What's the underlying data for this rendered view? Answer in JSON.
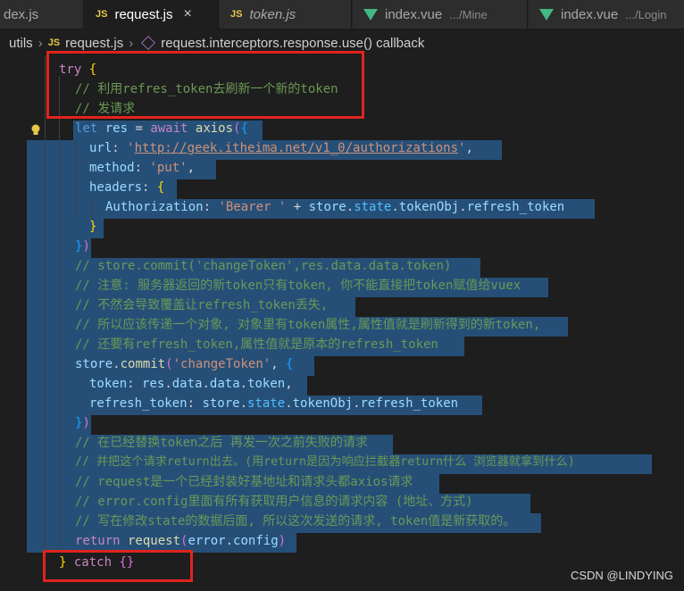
{
  "tabs": [
    {
      "icon": "none",
      "label": "dex.js",
      "sub": "",
      "italic": false,
      "active": false
    },
    {
      "icon": "js",
      "label": "request.js",
      "sub": "",
      "italic": false,
      "active": true,
      "close": "×"
    },
    {
      "icon": "js",
      "label": "token.js",
      "sub": "",
      "italic": true,
      "active": false
    },
    {
      "icon": "vue",
      "label": "index.vue",
      "sub": ".../Mine",
      "italic": false,
      "active": false
    },
    {
      "icon": "vue",
      "label": "index.vue",
      "sub": ".../Login",
      "italic": false,
      "active": false
    }
  ],
  "breadcrumb": {
    "folder": "utils",
    "file_icon": "JS",
    "file": "request.js",
    "symbol": "request.interceptors.response.use() callback"
  },
  "code": {
    "l1": {
      "a": "try",
      "b": " {"
    },
    "l2": "// 利用refres_token去刷新一个新的token",
    "l3": "// 发请求",
    "l4": {
      "a": "let",
      "b": " res",
      "c": " = ",
      "d": "await",
      "e": " axios",
      "f": "(",
      "g": "{"
    },
    "l5": {
      "a": "url",
      "b": ": ",
      "c": "'",
      "d": "http://geek.itheima.net/v1_0/authorizations",
      "e": "'",
      ",": ","
    },
    "l6": {
      "a": "method",
      "b": ": ",
      "c": "'put'",
      "d": ","
    },
    "l7": {
      "a": "headers",
      "b": ": ",
      "c": "{"
    },
    "l8": {
      "a": "Authorization",
      "b": ": ",
      "c": "'Bearer '",
      "d": " + ",
      "e": "store",
      "f": ".",
      "g": "state",
      "h": ".",
      "i": "tokenObj",
      "j": ".",
      "k": "refresh_token"
    },
    "l9": "}",
    "l10": {
      "a": "}",
      "b": ")"
    },
    "l11": "// store.commit('changeToken',res.data.data.token)",
    "l12": "// 注意: 服务器返回的新token只有token, 你不能直接把token赋值给vuex",
    "l13": "// 不然会导致覆盖让refresh_token丢失,",
    "l14": "// 所以应该传递一个对象, 对象里有token属性,属性值就是刷新得到的新token,",
    "l15": "// 还要有refresh_token,属性值就是原本的refresh_token",
    "l16": {
      "a": "store",
      "b": ".",
      "c": "commit",
      "d": "(",
      "e": "'changeToken'",
      "f": ", ",
      "g": "{"
    },
    "l17": {
      "a": "token",
      "b": ": ",
      "c": "res",
      "d": ".",
      "e": "data",
      "f": ".",
      "g": "data",
      "h": ".",
      "i": "token",
      ",": ","
    },
    "l18": {
      "a": "refresh_token",
      "b": ": ",
      "c": "store",
      "d": ".",
      "e": "state",
      "f": ".",
      "g": "tokenObj",
      "h": ".",
      "i": "refresh_token"
    },
    "l19": {
      "a": "}",
      "b": ")"
    },
    "l20": "// 在已经替换token之后 再发一次之前失败的请求",
    "l21": "// 并把这个请求return出去。(用return是因为响应拦截器return什么 浏览器就拿到什么)",
    "l22": "// request是一个已经封装好基地址和请求头都axios请求",
    "l23": "// error.config里面有所有获取用户信息的请求内容 (地址、方式)",
    "l24": "// 写在修改state的数据后面, 所以这次发送的请求, token值是新获取的。",
    "l25": {
      "a": "return",
      "b": " request",
      "c": "(",
      "d": "error",
      "e": ".",
      "f": "config",
      "g": ")"
    },
    "l26": {
      "a": "} ",
      "b": "catch",
      "c": " {}"
    }
  },
  "watermark": "CSDN @LINDYING",
  "colors": {
    "highlight_box": "#e0241d",
    "selection": "#264f78"
  }
}
